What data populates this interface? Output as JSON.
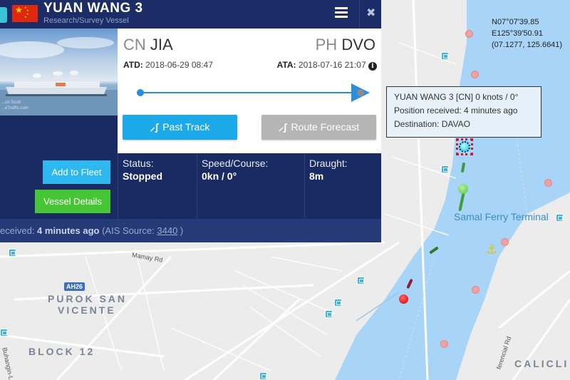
{
  "vessel": {
    "name": "YUAN WANG 3",
    "type": "Research/Survey Vessel",
    "flag_country": "CN",
    "photo_credit_line1": "...on Scott",
    "photo_credit_line2": "...eTraffic.com"
  },
  "header": {
    "menu_icon": "hamburger-menu-icon",
    "close_icon": "close-icon",
    "close_glyph": "✖"
  },
  "route": {
    "departure_country": "CN",
    "departure_port": "JIA",
    "arrival_country": "PH",
    "arrival_port": "DVO",
    "atd_label": "ATD:",
    "atd_value": "2018-06-29 08:47",
    "ata_label": "ATA:",
    "ata_value": "2018-07-16 21:07",
    "info_glyph": "i",
    "progress_percent": 100
  },
  "buttons": {
    "past_track": "Past Track",
    "route_forecast": "Route Forecast",
    "add_to_fleet": "Add to Fleet",
    "vessel_details": "Vessel Details",
    "track_glyph": "⸝ʃ"
  },
  "stats": [
    {
      "label": "Status:",
      "value": "Stopped"
    },
    {
      "label": "Speed/Course:",
      "value": "0kn / 0°"
    },
    {
      "label": "Draught:",
      "value": "8m"
    }
  ],
  "footer": {
    "prefix": "eceived: ",
    "age": "4 minutes ago",
    "source_prefix": " (AIS Source: ",
    "source_id": "3440",
    "source_suffix": " )"
  },
  "map": {
    "coordinates": {
      "lat_dms": "N07°07'39.85",
      "lon_dms": "E125°39'50.91",
      "decimal": "(07.1277, 125.6641)"
    },
    "tooltip": {
      "line1": "YUAN WANG 3 [CN] 0 knots / 0°",
      "line2": "Position received: 4 minutes ago",
      "line3": "Destination: DAVAO"
    },
    "labels": {
      "ferry_terminal": "Samal Ferry Terminal",
      "purok_1": "PUROK SAN",
      "purok_2": "VICENTE",
      "block": "BLOCK 12",
      "calicli": "CALICLI",
      "mamay_rd": "Mamay Rd",
      "diferencial_rd": "ferencial Rd",
      "buhangin": "Buhangin-L",
      "highway": "AH26"
    },
    "anchor_glyph": "⚓",
    "colors": {
      "water": "#a8d4f7",
      "land": "#ececec",
      "panel": "#1a2b63",
      "accent_blue": "#1ba9ea",
      "accent_green": "#46c634"
    }
  }
}
